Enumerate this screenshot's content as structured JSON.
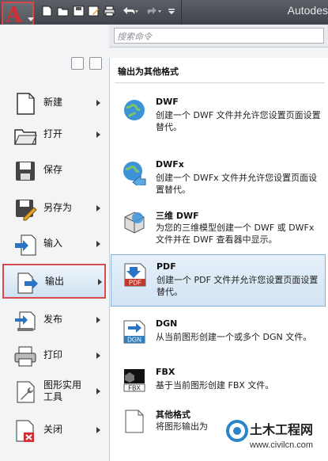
{
  "window": {
    "title_fragment": "Autodes"
  },
  "search": {
    "placeholder": "搜索命令"
  },
  "app_button": {
    "letter": "A"
  },
  "quick_access": [
    "new-icon",
    "open-icon",
    "save-icon",
    "saveas-icon",
    "print-icon",
    "undo-icon",
    "redo-icon",
    "dropdown-icon"
  ],
  "left_menu": [
    {
      "label": "新建",
      "icon": "new-document-icon",
      "submenu": true
    },
    {
      "label": "打开",
      "icon": "open-folder-icon",
      "submenu": true
    },
    {
      "label": "保存",
      "icon": "save-disk-icon",
      "submenu": false
    },
    {
      "label": "另存为",
      "icon": "saveas-disk-icon",
      "submenu": true
    },
    {
      "label": "输入",
      "icon": "import-icon",
      "submenu": true
    },
    {
      "label": "输出",
      "icon": "export-icon",
      "submenu": true,
      "selected": true
    },
    {
      "label": "发布",
      "icon": "publish-icon",
      "submenu": true
    },
    {
      "label": "打印",
      "icon": "printer-icon",
      "submenu": true
    },
    {
      "label": "图形实用\n工具",
      "icon": "wrench-icon",
      "submenu": true
    },
    {
      "label": "关闭",
      "icon": "close-document-icon",
      "submenu": true
    }
  ],
  "export_panel": {
    "title": "输出为其他格式",
    "items": [
      {
        "title": "DWF",
        "desc": "创建一个 DWF 文件并允许您设置页面设置替代。",
        "icon": "globe-icon"
      },
      {
        "title": "DWFx",
        "desc": "创建一个 DWFx 文件并允许您设置页面设置替代。",
        "icon": "globe-arrow-icon"
      },
      {
        "title": "三维 DWF",
        "desc": "为您的三维模型创建一个 DWF 或 DWFx 文件并在 DWF 查看器中显示。",
        "icon": "cube-icon"
      },
      {
        "title": "PDF",
        "desc": "创建一个 PDF 文件并允许您设置页面设置替代。",
        "icon": "pdf-icon",
        "selected": true
      },
      {
        "title": "DGN",
        "desc": "从当前图形创建一个或多个 DGN 文件。",
        "icon": "dgn-icon"
      },
      {
        "title": "FBX",
        "desc": "基于当前图形创建 FBX 文件。",
        "icon": "fbx-icon"
      },
      {
        "title": "其他格式",
        "desc": "将图形输出为",
        "icon": "other-format-icon"
      }
    ]
  },
  "watermark": {
    "name": "土木工程网",
    "url": "www.civilcn.com"
  },
  "colors": {
    "highlight_red": "#d64b4f",
    "selection_blue": "#86b1da",
    "toolbar_dark": "#4a4f56"
  }
}
